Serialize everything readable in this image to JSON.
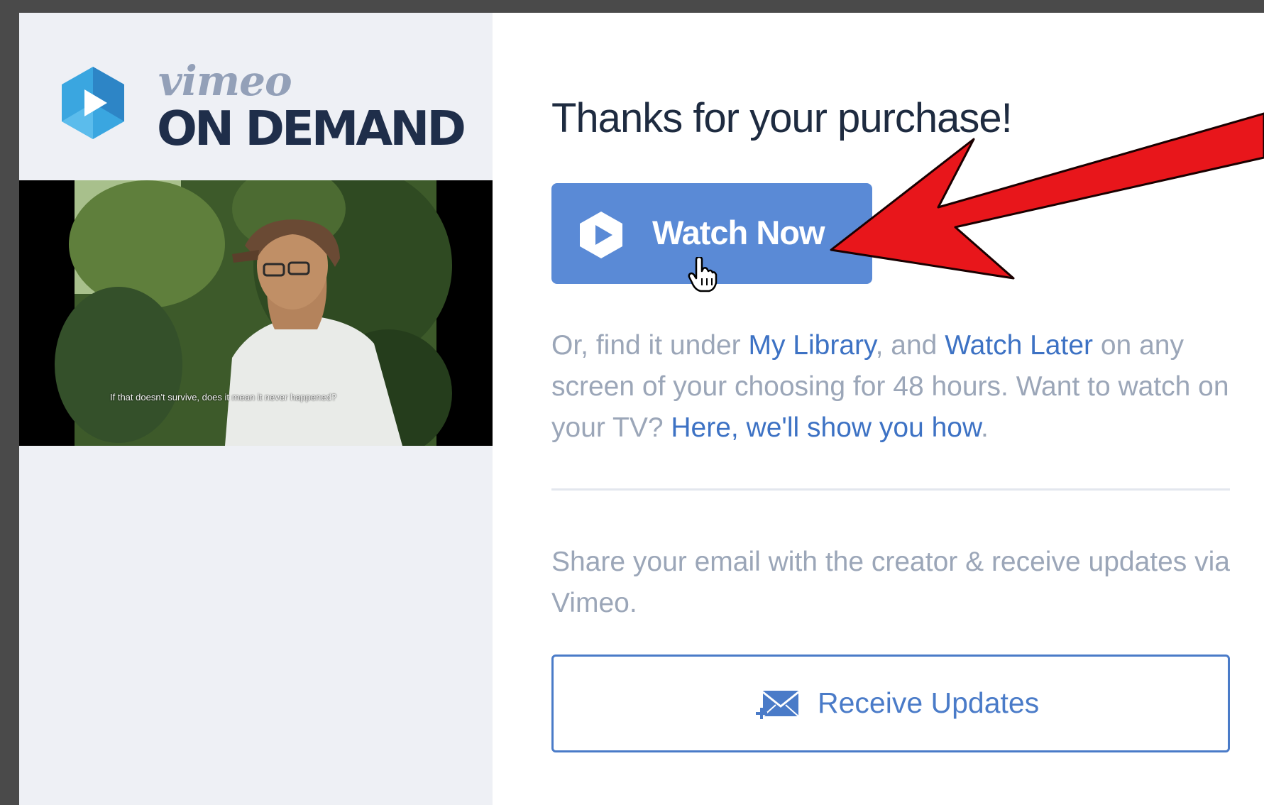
{
  "sidebar": {
    "logo": {
      "small_text": "vimeo",
      "big_text": "ON DEMAND"
    },
    "video": {
      "subtitle": "If that doesn't survive, does it mean it never happened?"
    }
  },
  "main": {
    "heading": "Thanks for your purchase!",
    "watch_button": {
      "label": "Watch Now",
      "icon": "play-icon"
    },
    "description": {
      "part1": "Or, find it under ",
      "link_my_library": "My Library",
      "part2": ", and ",
      "link_watch_later": "Watch Later",
      "part3": " on any screen of your choosing for 48 hours. Want to watch on your TV? ",
      "link_tv": "Here, we'll show you how",
      "part4": "."
    },
    "share_text": "Share your email with the creator & receive updates via Vimeo.",
    "receive_button": {
      "label": "Receive Updates",
      "icon": "envelope-add-icon"
    }
  },
  "colors": {
    "accent": "#5a8ad6",
    "link": "#3d72c4",
    "heading": "#1e2b40",
    "muted_text": "#9ba6b8",
    "sidebar_bg": "#eef0f5",
    "annotation_arrow": "#e8161b"
  }
}
